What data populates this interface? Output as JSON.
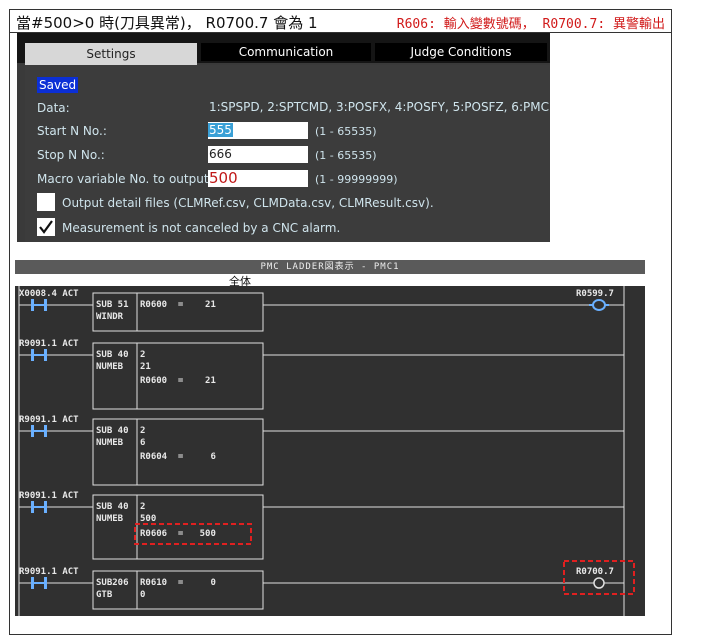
{
  "header": {
    "left": "當#500>0 時(刀具異常)， R0700.7 會為 1",
    "right": "R606: 輸入變數號碼， R0700.7: 異警輸出"
  },
  "settings": {
    "tabs": [
      "Settings",
      "Communication",
      "Judge Conditions"
    ],
    "saved": "Saved",
    "data_label": "Data:",
    "data_value": "1:SPSPD, 2:SPTCMD, 3:POSFX, 4:POSFY, 5:POSFZ, 6:PMC",
    "start_label": "Start N No.:",
    "start_value": "555",
    "start_range": "(1 - 65535)",
    "stop_label": "Stop N No.:",
    "stop_value": "666",
    "stop_range": "(1 - 65535)",
    "macro_label": "Macro variable No. to output:",
    "macro_value": "500",
    "macro_range": "(1 - 99999999)",
    "chk1_label": "Output detail files (CLMRef.csv, CLMData.csv, CLMResult.csv).",
    "chk1_checked": false,
    "chk2_label": "Measurement is not canceled by a CNC alarm.",
    "chk2_checked": true
  },
  "ladder": {
    "title": "PMC LADDER図表示 - PMC1",
    "subtitle": "全体",
    "rungs": [
      {
        "contact": "X0008.4 ACT",
        "func": "SUB 51",
        "func_name": "WINDR",
        "lines": [
          "R0600  =    21"
        ],
        "coil": "R0599.7"
      },
      {
        "contact": "R9091.1 ACT",
        "func": "SUB 40",
        "func_name": "NUMEB",
        "lines": [
          "2",
          "21",
          "R0600  =    21"
        ]
      },
      {
        "contact": "R9091.1 ACT",
        "func": "SUB 40",
        "func_name": "NUMEB",
        "lines": [
          "2",
          "6",
          "R0604  =     6"
        ]
      },
      {
        "contact": "R9091.1 ACT",
        "func": "SUB 40",
        "func_name": "NUMEB",
        "lines": [
          "2",
          "500",
          "R0606  =   500"
        ]
      },
      {
        "contact": "R9091.1 ACT",
        "func": "SUB206",
        "func_name": "GTB",
        "lines": [
          "R0610  =     0",
          "0"
        ],
        "coil": "R0700.7"
      }
    ]
  },
  "colors": {
    "accent_red": "#d11a1a",
    "ladder_bg": "#303030",
    "panel_bg": "#3a3a3a"
  }
}
